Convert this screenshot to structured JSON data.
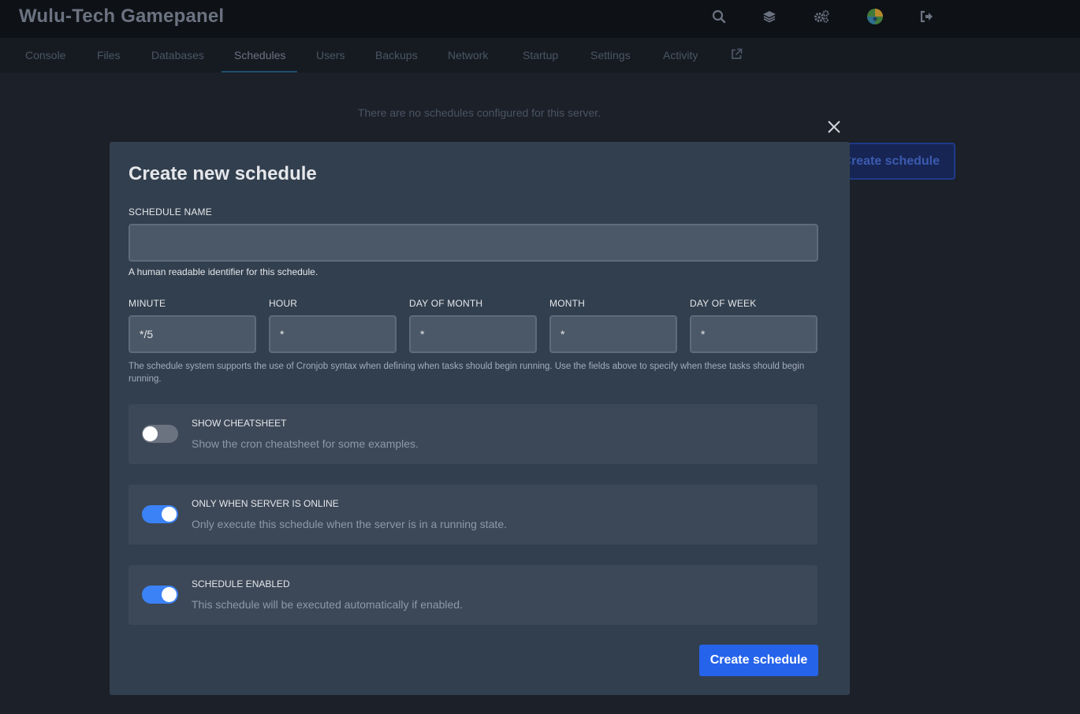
{
  "app": {
    "title": "Wulu-Tech Gamepanel"
  },
  "topbar_icons": [
    "search-icon",
    "layers-icon",
    "cogs-icon",
    "avatar",
    "sign-out-icon"
  ],
  "tabs": [
    {
      "label": "Console"
    },
    {
      "label": "Files"
    },
    {
      "label": "Databases"
    },
    {
      "label": "Schedules",
      "active": true
    },
    {
      "label": "Users"
    },
    {
      "label": "Backups"
    },
    {
      "label": "Network"
    },
    {
      "label": "Startup"
    },
    {
      "label": "Settings"
    },
    {
      "label": "Activity"
    }
  ],
  "background": {
    "empty_message": "There are no schedules configured for this server.",
    "create_button": "Create schedule"
  },
  "modal": {
    "title": "Create new schedule",
    "name_label": "SCHEDULE NAME",
    "name_value": "",
    "name_hint": "A human readable identifier for this schedule.",
    "cron": [
      {
        "label": "MINUTE",
        "value": "*/5"
      },
      {
        "label": "HOUR",
        "value": "*"
      },
      {
        "label": "DAY OF MONTH",
        "value": "*"
      },
      {
        "label": "MONTH",
        "value": "*"
      },
      {
        "label": "DAY OF WEEK",
        "value": "*"
      }
    ],
    "cron_hint": "The schedule system supports the use of Cronjob syntax when defining when tasks should begin running. Use the fields above to specify when these tasks should begin running.",
    "toggles": [
      {
        "title": "SHOW CHEATSHEET",
        "description": "Show the cron cheatsheet for some examples.",
        "enabled": false
      },
      {
        "title": "ONLY WHEN SERVER IS ONLINE",
        "description": "Only execute this schedule when the server is in a running state.",
        "enabled": true
      },
      {
        "title": "SCHEDULE ENABLED",
        "description": "This schedule will be executed automatically if enabled.",
        "enabled": true
      }
    ],
    "submit_label": "Create schedule"
  },
  "colors": {
    "accent": "#2563eb",
    "toggle_on": "#3b82f6",
    "modal_bg": "#323f4e",
    "page_bg": "#1b2029"
  }
}
